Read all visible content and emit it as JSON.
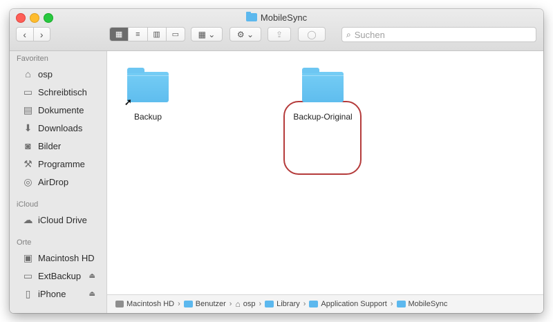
{
  "window": {
    "title": "MobileSync"
  },
  "toolbar": {
    "back_glyph": "‹",
    "forward_glyph": "›",
    "view_icons": [
      "icon-view-icon",
      "list-view-icon",
      "column-view-icon",
      "gallery-view-icon"
    ],
    "group_glyph": "▦ ⌄",
    "action_glyph": "⚙ ⌄",
    "share_glyph": "⇪",
    "tag_glyph": "◯"
  },
  "search": {
    "placeholder": "Suchen"
  },
  "sidebar": {
    "sections": [
      {
        "title": "Favoriten",
        "items": [
          {
            "label": "osp",
            "icon": "home-icon"
          },
          {
            "label": "Schreibtisch",
            "icon": "desktop-icon"
          },
          {
            "label": "Dokumente",
            "icon": "documents-icon"
          },
          {
            "label": "Downloads",
            "icon": "downloads-icon"
          },
          {
            "label": "Bilder",
            "icon": "camera-icon"
          },
          {
            "label": "Programme",
            "icon": "applications-icon"
          },
          {
            "label": "AirDrop",
            "icon": "airdrop-icon"
          }
        ]
      },
      {
        "title": "iCloud",
        "items": [
          {
            "label": "iCloud Drive",
            "icon": "cloud-icon"
          }
        ]
      },
      {
        "title": "Orte",
        "items": [
          {
            "label": "Macintosh HD",
            "icon": "hard-drive-icon"
          },
          {
            "label": "ExtBackup",
            "icon": "external-drive-icon",
            "eject": true
          },
          {
            "label": "iPhone",
            "icon": "iphone-icon",
            "eject": true
          }
        ]
      }
    ]
  },
  "files": [
    {
      "name": "Backup",
      "alias": true
    },
    {
      "name": "Backup-Original",
      "alias": false,
      "highlighted": true
    }
  ],
  "path": [
    "Macintosh HD",
    "Benutzer",
    "osp",
    "Library",
    "Application Support",
    "MobileSync"
  ],
  "colors": {
    "folder": "#5fbdee",
    "highlight": "#b43a3a",
    "close": "#fe5f57",
    "minimize": "#febc2e",
    "maximize": "#28c840"
  }
}
